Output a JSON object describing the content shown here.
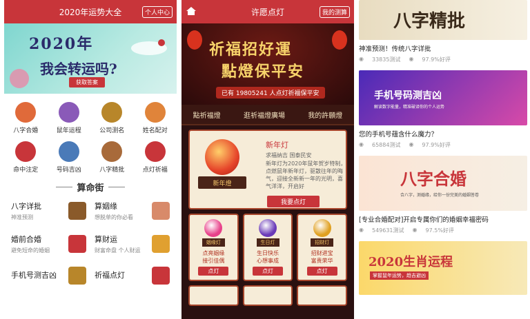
{
  "panel1": {
    "header_title": "2020年运势大全",
    "header_button": "个人中心",
    "banner": {
      "line1": "2020年",
      "line2": "我会转运吗?",
      "button": "获取答案"
    },
    "grid": [
      {
        "label": "八字合婚",
        "icon": "rings-icon",
        "color": "#e06a3a"
      },
      {
        "label": "鼠年运程",
        "icon": "moon-icon",
        "color": "#8a5ab8"
      },
      {
        "label": "公司测名",
        "icon": "cards-icon",
        "color": "#b8862a"
      },
      {
        "label": "姓名配对",
        "icon": "couple-icon",
        "color": "#e0843a"
      },
      {
        "label": "命中注定",
        "icon": "person-icon",
        "color": "#c8353a"
      },
      {
        "label": "号码吉凶",
        "icon": "magnifier-icon",
        "color": "#4a7ab8"
      },
      {
        "label": "八字精批",
        "icon": "scroll-icon",
        "color": "#a86a3a"
      },
      {
        "label": "点灯祈福",
        "icon": "lantern-icon",
        "color": "#c8353a"
      }
    ],
    "section_title": "算命街",
    "list": [
      {
        "title": "八字详批",
        "sub": "神准预测",
        "color": "#8a5a2a"
      },
      {
        "title": "算姻缘",
        "sub": "想脱单的你必看",
        "color": "#d88a6a"
      },
      {
        "title": "婚前合婚",
        "sub": "避免短命的婚姻",
        "color": "#c8353a"
      },
      {
        "title": "算财运",
        "sub": "财富命盘 个人财运",
        "color": "#e0a030"
      },
      {
        "title": "手机号测吉凶",
        "sub": "",
        "color": "#b8862a"
      },
      {
        "title": "祈福点灯",
        "sub": "",
        "color": "#c8353a"
      }
    ]
  },
  "panel2": {
    "header_title": "许愿点灯",
    "header_button": "我的测算",
    "banner": {
      "line1": "祈福招好運",
      "line2": "點燈保平安",
      "count_text": "已有 19805241 人点灯祈福保平安"
    },
    "tabs": [
      "點祈福燈",
      "逛祈福燈廣場",
      "我的許願燈"
    ],
    "featured": {
      "title": "新年灯",
      "sub": "求福纳吉 国泰民安",
      "desc": "新年灯为2020年鼠年贺岁特制，点燃鼠年新年灯，驱散往年的晦气，迎接全新新一年的光明，喜气洋洋，开启好",
      "lamp_label": "新年燈",
      "button": "我要点灯"
    },
    "lamps": [
      {
        "tag": "姻缘灯",
        "line1": "点亮姻缘",
        "line2": "接引佳偶",
        "button": "点灯",
        "color": "#e8408a"
      },
      {
        "tag": "生日灯",
        "line1": "生日快乐",
        "line2": "心想事成",
        "button": "点灯",
        "color": "#6a3ab8"
      },
      {
        "tag": "招财灯",
        "line1": "招财进宝",
        "line2": "富贵荣华",
        "button": "点灯",
        "color": "#e0a020"
      }
    ]
  },
  "panel3": {
    "ads": [
      {
        "banner_text": "八字精批",
        "title": "神准预测！传统八字详批",
        "tests": "33835测试",
        "rating": "97.9%好评"
      },
      {
        "banner_text": "手机号码测吉凶",
        "banner_sub": "解读数字能量，精准破译你的个人运势",
        "title": "您的手机号蕴含什么魔力？",
        "tests": "65884测试",
        "rating": "97.9%好评"
      },
      {
        "banner_text": "八字合婚",
        "banner_sub": "合八字，测婚缘，给你一份完美的婚姻答卷",
        "title": "[专业合婚配对]开启专属你们的婚姻幸福密码",
        "tests": "549631测试",
        "rating": "97.5%好评"
      },
      {
        "banner_text": "2020生肖运程",
        "banner_sub": "掌握鼠年运势，趋吉避凶"
      }
    ]
  }
}
